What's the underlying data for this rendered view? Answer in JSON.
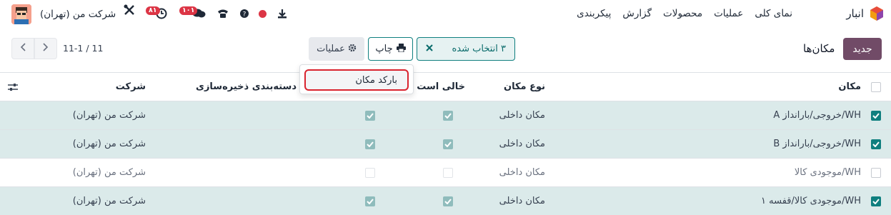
{
  "navbar": {
    "app_name": "انبار",
    "menu": [
      "نمای کلی",
      "عملیات",
      "محصولات",
      "گزارش",
      "پیکربندی"
    ],
    "company": "شرکت من (تهران)",
    "activity_badge": "۸۱",
    "messages_badge": "۱۰۱"
  },
  "control": {
    "new_label": "جدید",
    "breadcrumb": "مکان‌ها",
    "selected_label": "۳ انتخاب شده",
    "print_label": "چاپ",
    "actions_label": "عملیات",
    "pager": "11-1 / 11"
  },
  "dropdown": {
    "item": "بارکد مکان"
  },
  "table": {
    "headers": {
      "name": "مکان",
      "type": "نوع مکان",
      "empty": "خالی است",
      "storage": "دسته‌بندی ذخیره‌سازی",
      "company": "شرکت"
    },
    "rows": [
      {
        "name": "WH/خروجی/بارانداز A",
        "type": "مکان داخلی",
        "company": "شرکت من (تهران)",
        "selected": true
      },
      {
        "name": "WH/خروجی/بارانداز B",
        "type": "مکان داخلی",
        "company": "شرکت من (تهران)",
        "selected": true
      },
      {
        "name": "WH/موجودی کالا",
        "type": "مکان داخلی",
        "company": "شرکت من (تهران)",
        "selected": false
      },
      {
        "name": "WH/موجودی کالا/قفسه ۱",
        "type": "مکان داخلی",
        "company": "شرکت من (تهران)",
        "selected": true
      }
    ]
  },
  "colors": {
    "brand": "#714b67",
    "accent": "#0f7f7f",
    "selected_row": "#dbeaea",
    "highlight": "#d9232e"
  }
}
